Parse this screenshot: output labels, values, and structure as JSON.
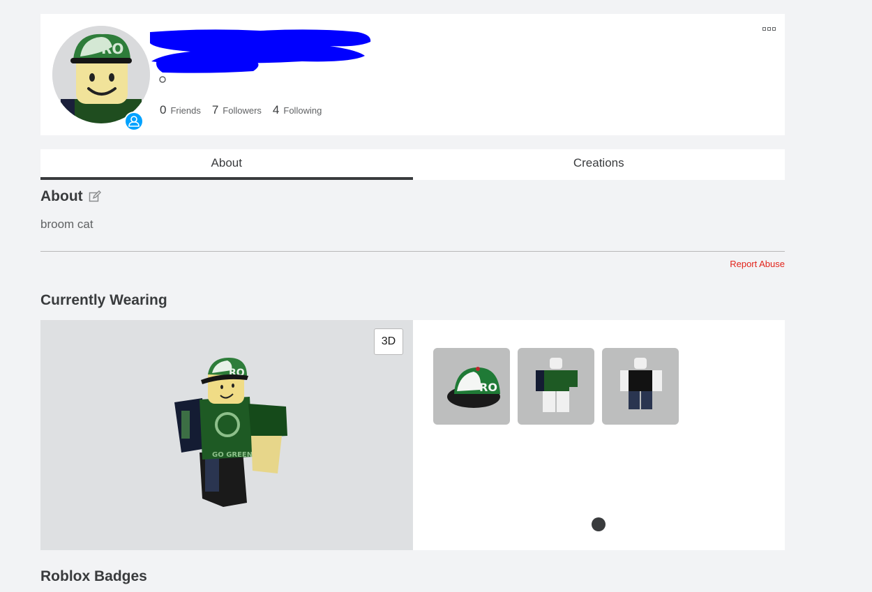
{
  "header": {
    "stats": [
      {
        "count": "0",
        "label": "Friends"
      },
      {
        "count": "7",
        "label": "Followers"
      },
      {
        "count": "4",
        "label": "Following"
      }
    ]
  },
  "tabs": [
    {
      "label": "About",
      "active": true
    },
    {
      "label": "Creations",
      "active": false
    }
  ],
  "about": {
    "title": "About",
    "body": "broom cat",
    "report_label": "Report Abuse"
  },
  "wearing": {
    "title": "Currently Wearing",
    "view_toggle_label": "3D",
    "items": [
      {
        "icon": "cap-item-icon"
      },
      {
        "icon": "shirt-item-icon"
      },
      {
        "icon": "pants-item-icon"
      }
    ]
  },
  "badges": {
    "title": "Roblox Badges"
  },
  "colors": {
    "accent": "#00a2ff",
    "report": "#e2231a",
    "redaction": "#0000ff"
  }
}
